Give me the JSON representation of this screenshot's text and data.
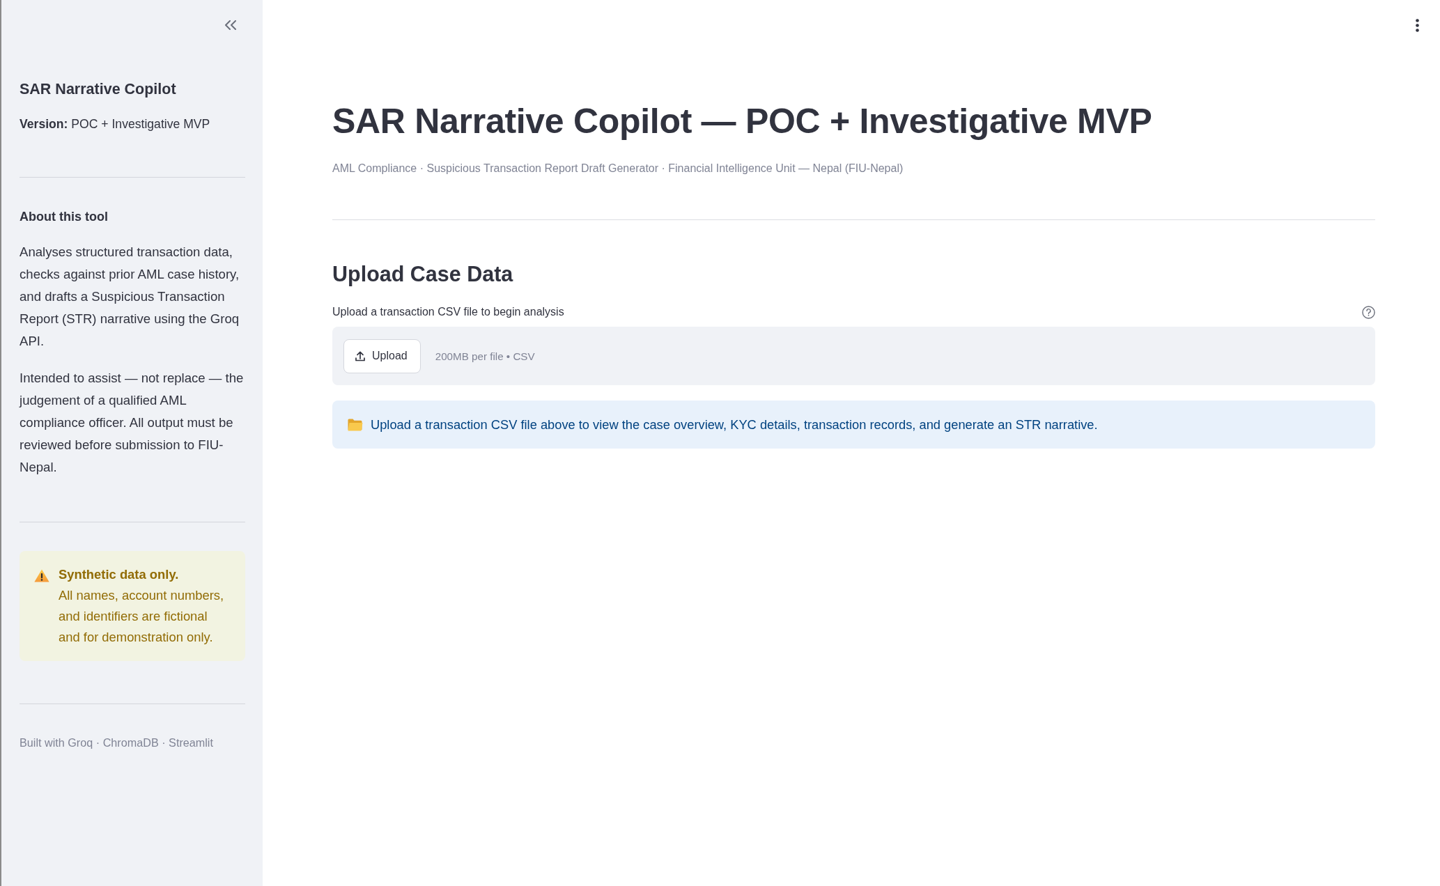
{
  "sidebar": {
    "title": "SAR Narrative Copilot",
    "version": "**Version:** POC + Investigative MVP",
    "about": {
      "heading": "About this tool",
      "paragraphs": [
        "Analyses structured transaction data, checks against prior AML case history, and drafts a Suspicious Transaction Report (STR) narrative using the Groq API.",
        "Intended to assist — not replace — the judgement of a qualified AML compliance officer. All output must be reviewed before submission to FIU-Nepal."
      ]
    },
    "warning": {
      "title": "Synthetic data only.",
      "text": "All names, account numbers, and identifiers are fictional and for demonstration only."
    },
    "footer": "Built with Groq · ChromaDB · Streamlit"
  },
  "header": {
    "title": "SAR Narrative Copilot — POC + Investigative MVP",
    "subtitle": "AML Compliance · Suspicious Transaction Report Draft Generator · Financial Intelligence Unit — Nepal (FIU-Nepal)"
  },
  "upload": {
    "heading": "Upload Case Data",
    "label": "Upload a transaction CSV file to begin analysis",
    "button": "Upload",
    "limits": "200MB per file • CSV"
  },
  "info": {
    "text": "Upload a transaction CSV file above to view the case overview, KYC details, transaction records, and generate an STR narrative."
  }
}
